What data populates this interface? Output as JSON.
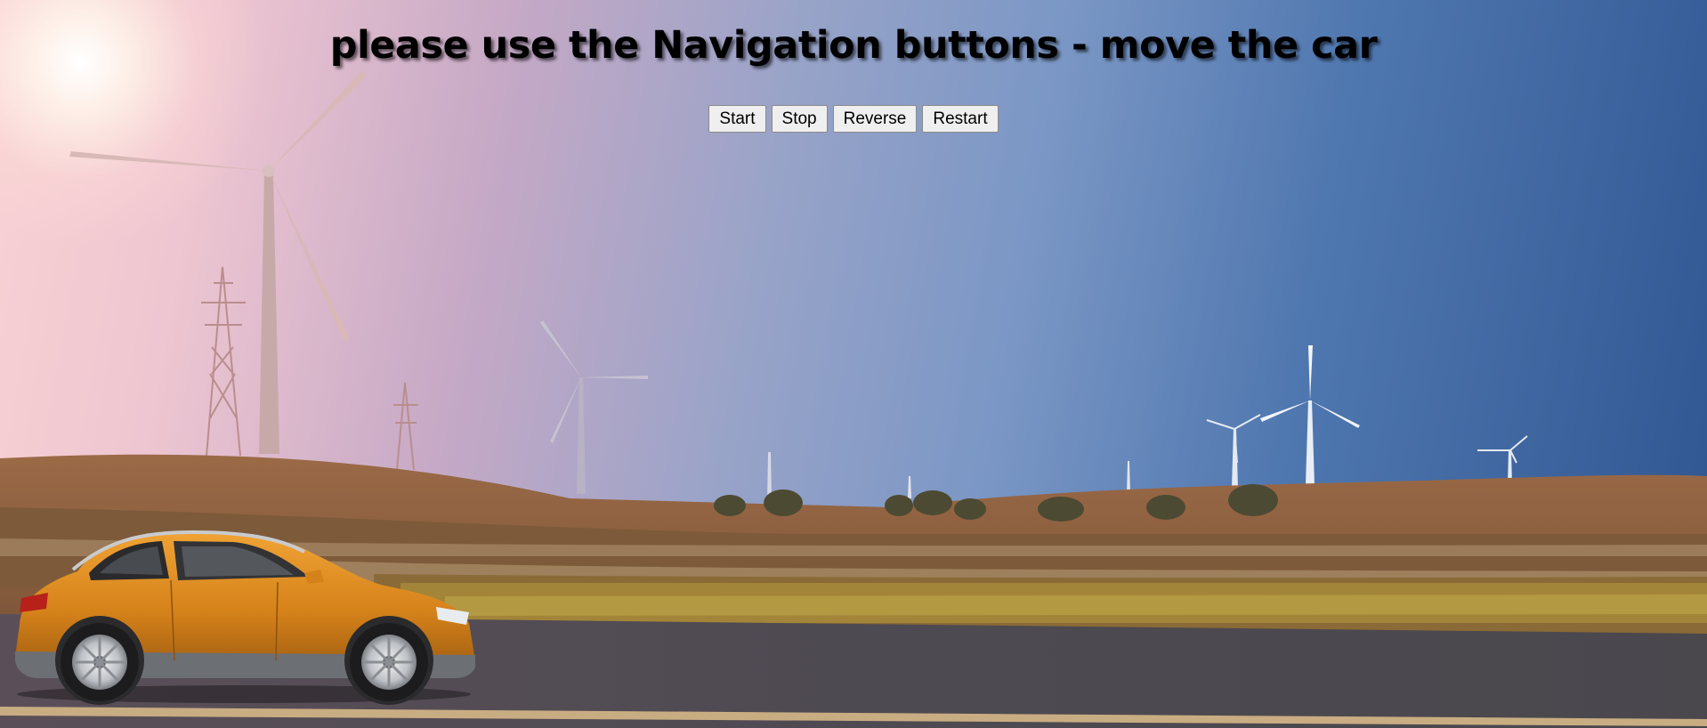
{
  "page": {
    "title": "please use the Navigation buttons - move the car"
  },
  "controls": {
    "start_label": "Start",
    "stop_label": "Stop",
    "reverse_label": "Reverse",
    "restart_label": "Restart"
  },
  "colors": {
    "sky_left": "#f8d2d4",
    "sky_right": "#2f5590",
    "car_body": "#d5821a",
    "road": "#4d4850",
    "field": "#7a5533"
  }
}
